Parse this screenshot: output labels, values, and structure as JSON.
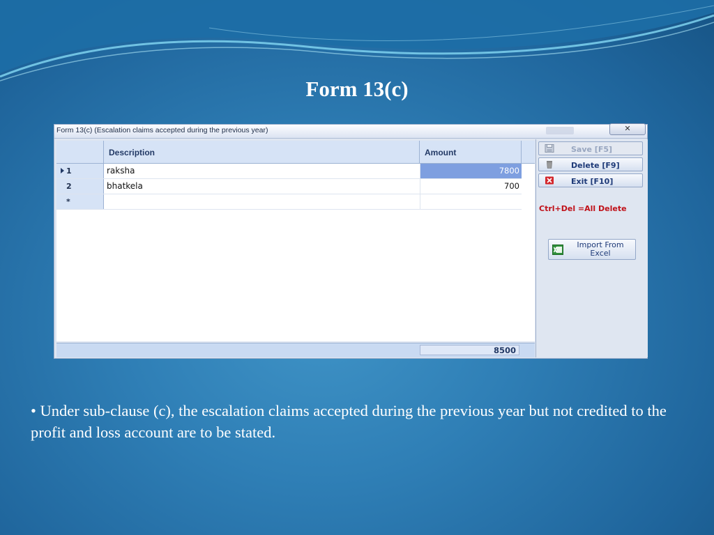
{
  "slide": {
    "title": "Form 13(c)",
    "bullet": "• Under sub-clause (c), the escalation claims accepted during the previous year but not credited to the profit and loss account are to be stated."
  },
  "window": {
    "title": "Form 13(c) (Escalation claims accepted during the previous year)",
    "close_label": "✕"
  },
  "grid": {
    "columns": [
      "Description",
      "Amount"
    ],
    "rows": [
      {
        "num": "1",
        "description": "raksha",
        "amount": "7800",
        "selected": true
      },
      {
        "num": "2",
        "description": "bhatkela",
        "amount": "700",
        "selected": false
      }
    ],
    "new_row_marker": "*",
    "total": "8500"
  },
  "actions": {
    "save_label": "Save [F5]",
    "delete_label": "Delete [F9]",
    "exit_label": "Exit [F10]",
    "hint": "Ctrl+Del =All Delete",
    "import_label_line1": "Import From",
    "import_label_line2": "Excel"
  },
  "colors": {
    "background": "#2f7fb6",
    "selected_cell": "#7e9fe0",
    "hint_text": "#c0121a"
  }
}
